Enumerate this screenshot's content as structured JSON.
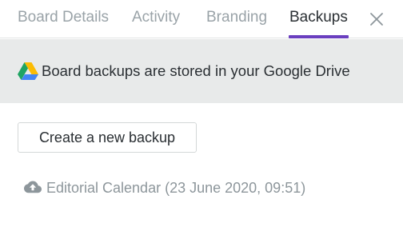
{
  "tabs": [
    {
      "label": "Board Details",
      "active": false
    },
    {
      "label": "Activity",
      "active": false
    },
    {
      "label": "Branding",
      "active": false
    },
    {
      "label": "Backups",
      "active": true
    }
  ],
  "accent_color": "#6a3fbf",
  "close_icon": "close-icon",
  "banner": {
    "icon": "google-drive-icon",
    "text": "Board backups are stored in your Google Drive"
  },
  "create_button": {
    "label": "Create a new backup"
  },
  "backups": [
    {
      "icon": "cloud-upload-icon",
      "label": "Editorial Calendar (23 June 2020, 09:51)"
    }
  ]
}
